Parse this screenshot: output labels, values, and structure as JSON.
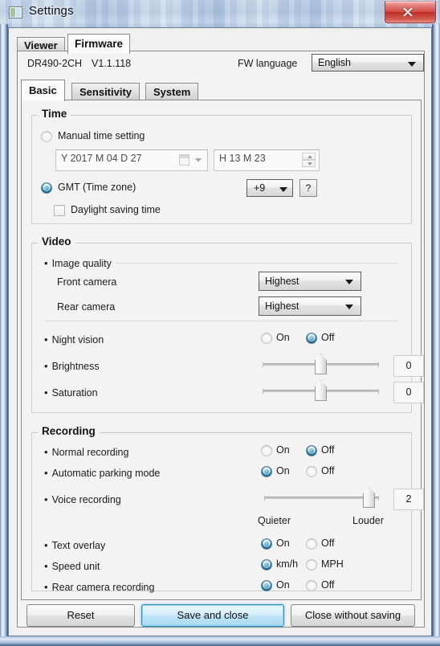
{
  "window": {
    "title": "Settings",
    "icon": "app-icon",
    "close_label": "x"
  },
  "outer_tabs": [
    {
      "label": "Viewer",
      "selected": false
    },
    {
      "label": "Firmware",
      "selected": true
    }
  ],
  "firmware_header": {
    "model": "DR490-2CH",
    "version": "V1.1.118",
    "language_label": "FW language",
    "language_value": "English"
  },
  "inner_tabs": [
    {
      "label": "Basic",
      "selected": true
    },
    {
      "label": "Sensitivity",
      "selected": false
    },
    {
      "label": "System",
      "selected": false
    }
  ],
  "time": {
    "title": "Time",
    "manual_label": "Manual time setting",
    "manual_selected": false,
    "date_value": "Y 2017 M 04 D 27",
    "time_value": "H 13 M 23",
    "gmt_label": "GMT (Time zone)",
    "gmt_selected": true,
    "gmt_value": "+9",
    "help_label": "?",
    "dst_label": "Daylight saving time",
    "dst_checked": false
  },
  "video": {
    "title": "Video",
    "image_quality_label": "Image quality",
    "front_camera_label": "Front camera",
    "front_camera_value": "Highest",
    "rear_camera_label": "Rear camera",
    "rear_camera_value": "Highest",
    "night_vision_label": "Night vision",
    "night_vision_on": "On",
    "night_vision_off": "Off",
    "night_vision_value": "Off",
    "brightness_label": "Brightness",
    "brightness_value": "0",
    "saturation_label": "Saturation",
    "saturation_value": "0"
  },
  "recording": {
    "title": "Recording",
    "normal_label": "Normal recording",
    "normal_on": "On",
    "normal_off": "Off",
    "normal_value": "Off",
    "parking_label": "Automatic parking mode",
    "parking_on": "On",
    "parking_off": "Off",
    "parking_value": "On",
    "voice_label": "Voice recording",
    "voice_value": "2",
    "voice_min_label": "Quieter",
    "voice_max_label": "Louder",
    "text_overlay_label": "Text overlay",
    "text_overlay_on": "On",
    "text_overlay_off": "Off",
    "text_overlay_value": "On",
    "speed_unit_label": "Speed unit",
    "speed_unit_kmh": "km/h",
    "speed_unit_mph": "MPH",
    "speed_unit_value": "km/h",
    "rear_recording_label": "Rear camera recording",
    "rear_recording_on": "On",
    "rear_recording_off": "Off",
    "rear_recording_value": "On"
  },
  "buttons": {
    "reset": "Reset",
    "save_and_close": "Save and close",
    "close_without_saving": "Close without saving"
  },
  "colors": {
    "accent": "#1d6787",
    "close_red": "#c63b31",
    "default_button": "#a9dbf3"
  }
}
